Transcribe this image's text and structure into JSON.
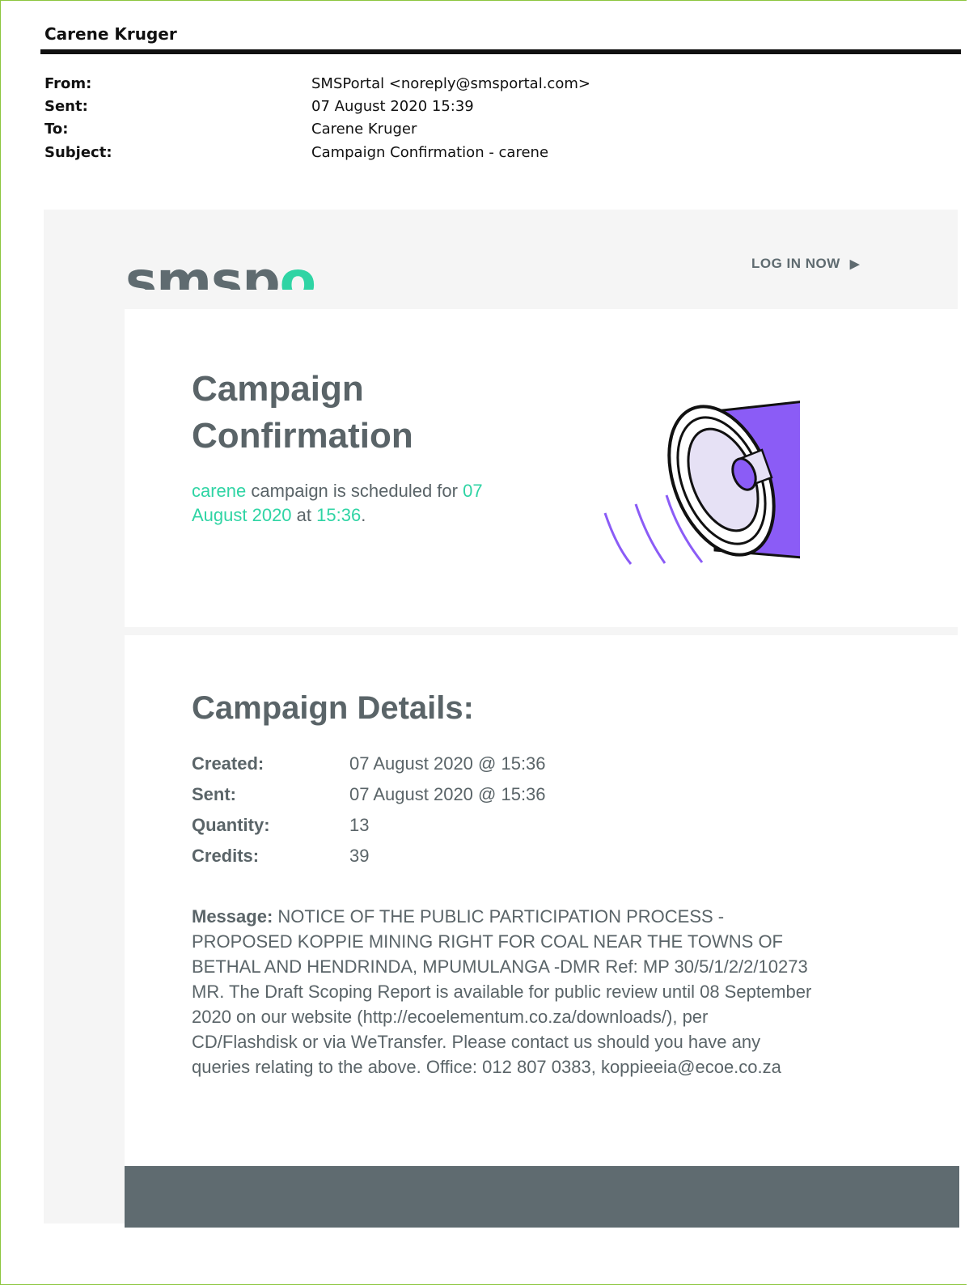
{
  "email": {
    "owner_name": "Carene Kruger",
    "from_label": "From:",
    "from": "SMSPortal <noreply@smsportal.com>",
    "sent_label": "Sent:",
    "sent": "07 August 2020 15:39",
    "to_label": "To:",
    "to": "Carene Kruger",
    "subject_label": "Subject:",
    "subject": "Campaign Confirmation - carene"
  },
  "brand": {
    "logo_text": "smsp",
    "logo_accent": "o",
    "login_label": "LOG IN NOW",
    "accent_color": "#2fd4a4",
    "text_color": "#5a6468",
    "illustration_color": "#8b5cf6"
  },
  "confirmation": {
    "title_line1": "Campaign",
    "title_line2": "Confirmation",
    "campaign_name": "carene",
    "text1": " campaign is scheduled for ",
    "date": "07 August 2020",
    "text2": " at ",
    "time": "15:36",
    "text3": "."
  },
  "details": {
    "title": "Campaign Details:",
    "created_label": "Created:",
    "created": "07 August 2020 @ 15:36",
    "sent_label": "Sent:",
    "sent": "07 August 2020 @ 15:36",
    "quantity_label": "Quantity:",
    "quantity": "13",
    "credits_label": "Credits:",
    "credits": "39",
    "message_label": "Message:",
    "message": "NOTICE OF THE PUBLIC PARTICIPATION PROCESS - PROPOSED KOPPIE MINING RIGHT FOR COAL NEAR THE TOWNS OF BETHAL AND HENDRINDA, MPUMULANGA -DMR Ref: MP 30/5/1/2/2/10273 MR. The Draft Scoping Report is available for public review until 08 September 2020 on our website (http://ecoelementum.co.za/downloads/), per CD/Flashdisk or via WeTransfer. Please contact us should you have any queries relating to the above. Office: 012 807 0383, koppieeia@ecoe.co.za"
  }
}
